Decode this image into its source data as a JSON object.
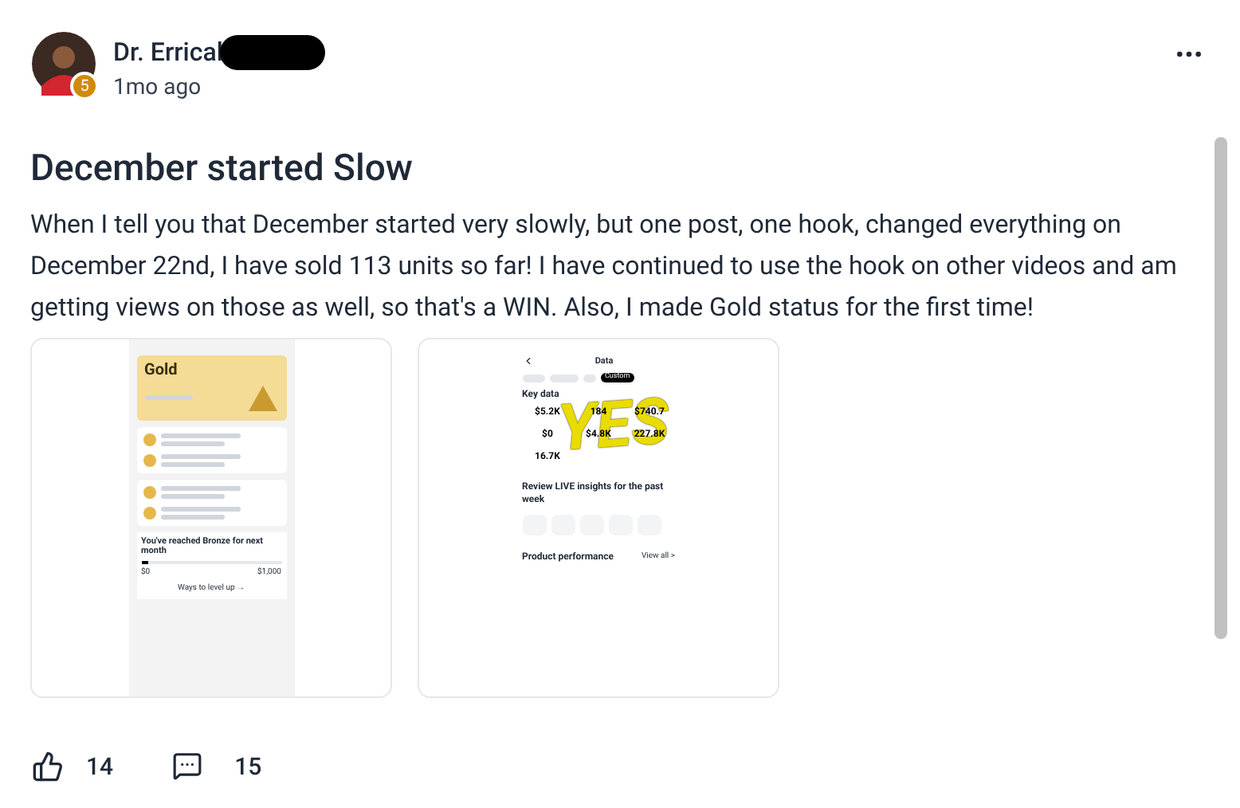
{
  "author": {
    "name": "Dr. Errical",
    "badge": "5",
    "time": "1mo ago"
  },
  "post": {
    "title": "December started Slow",
    "body": "When I tell you that December started very slowly, but one post, one hook, changed everything on December 22nd, I have sold 113 units so far! I have continued to use the hook on other videos and am getting views on those as well, so that's a WIN. Also, I made Gold status for the first time!"
  },
  "attachments": [
    {
      "kind": "tier",
      "tier": "Gold",
      "progress_title": "You've reached Bronze for next month",
      "level": 0.05,
      "min": "$0",
      "max": "$1,000",
      "link": "Ways to level up →"
    },
    {
      "kind": "data",
      "title": "Data",
      "filter": "Custom",
      "section": "Key data",
      "metrics": [
        "$5.2K",
        "184",
        "$740.7",
        "$0",
        "$4.8K",
        "227.8K",
        "16.7K"
      ],
      "annotation": "YES",
      "insight": "Review LIVE insights for the past week",
      "footer": "Product performance",
      "footer_link": "View all >"
    }
  ],
  "reactions": {
    "likes": "14",
    "comments": "15"
  }
}
